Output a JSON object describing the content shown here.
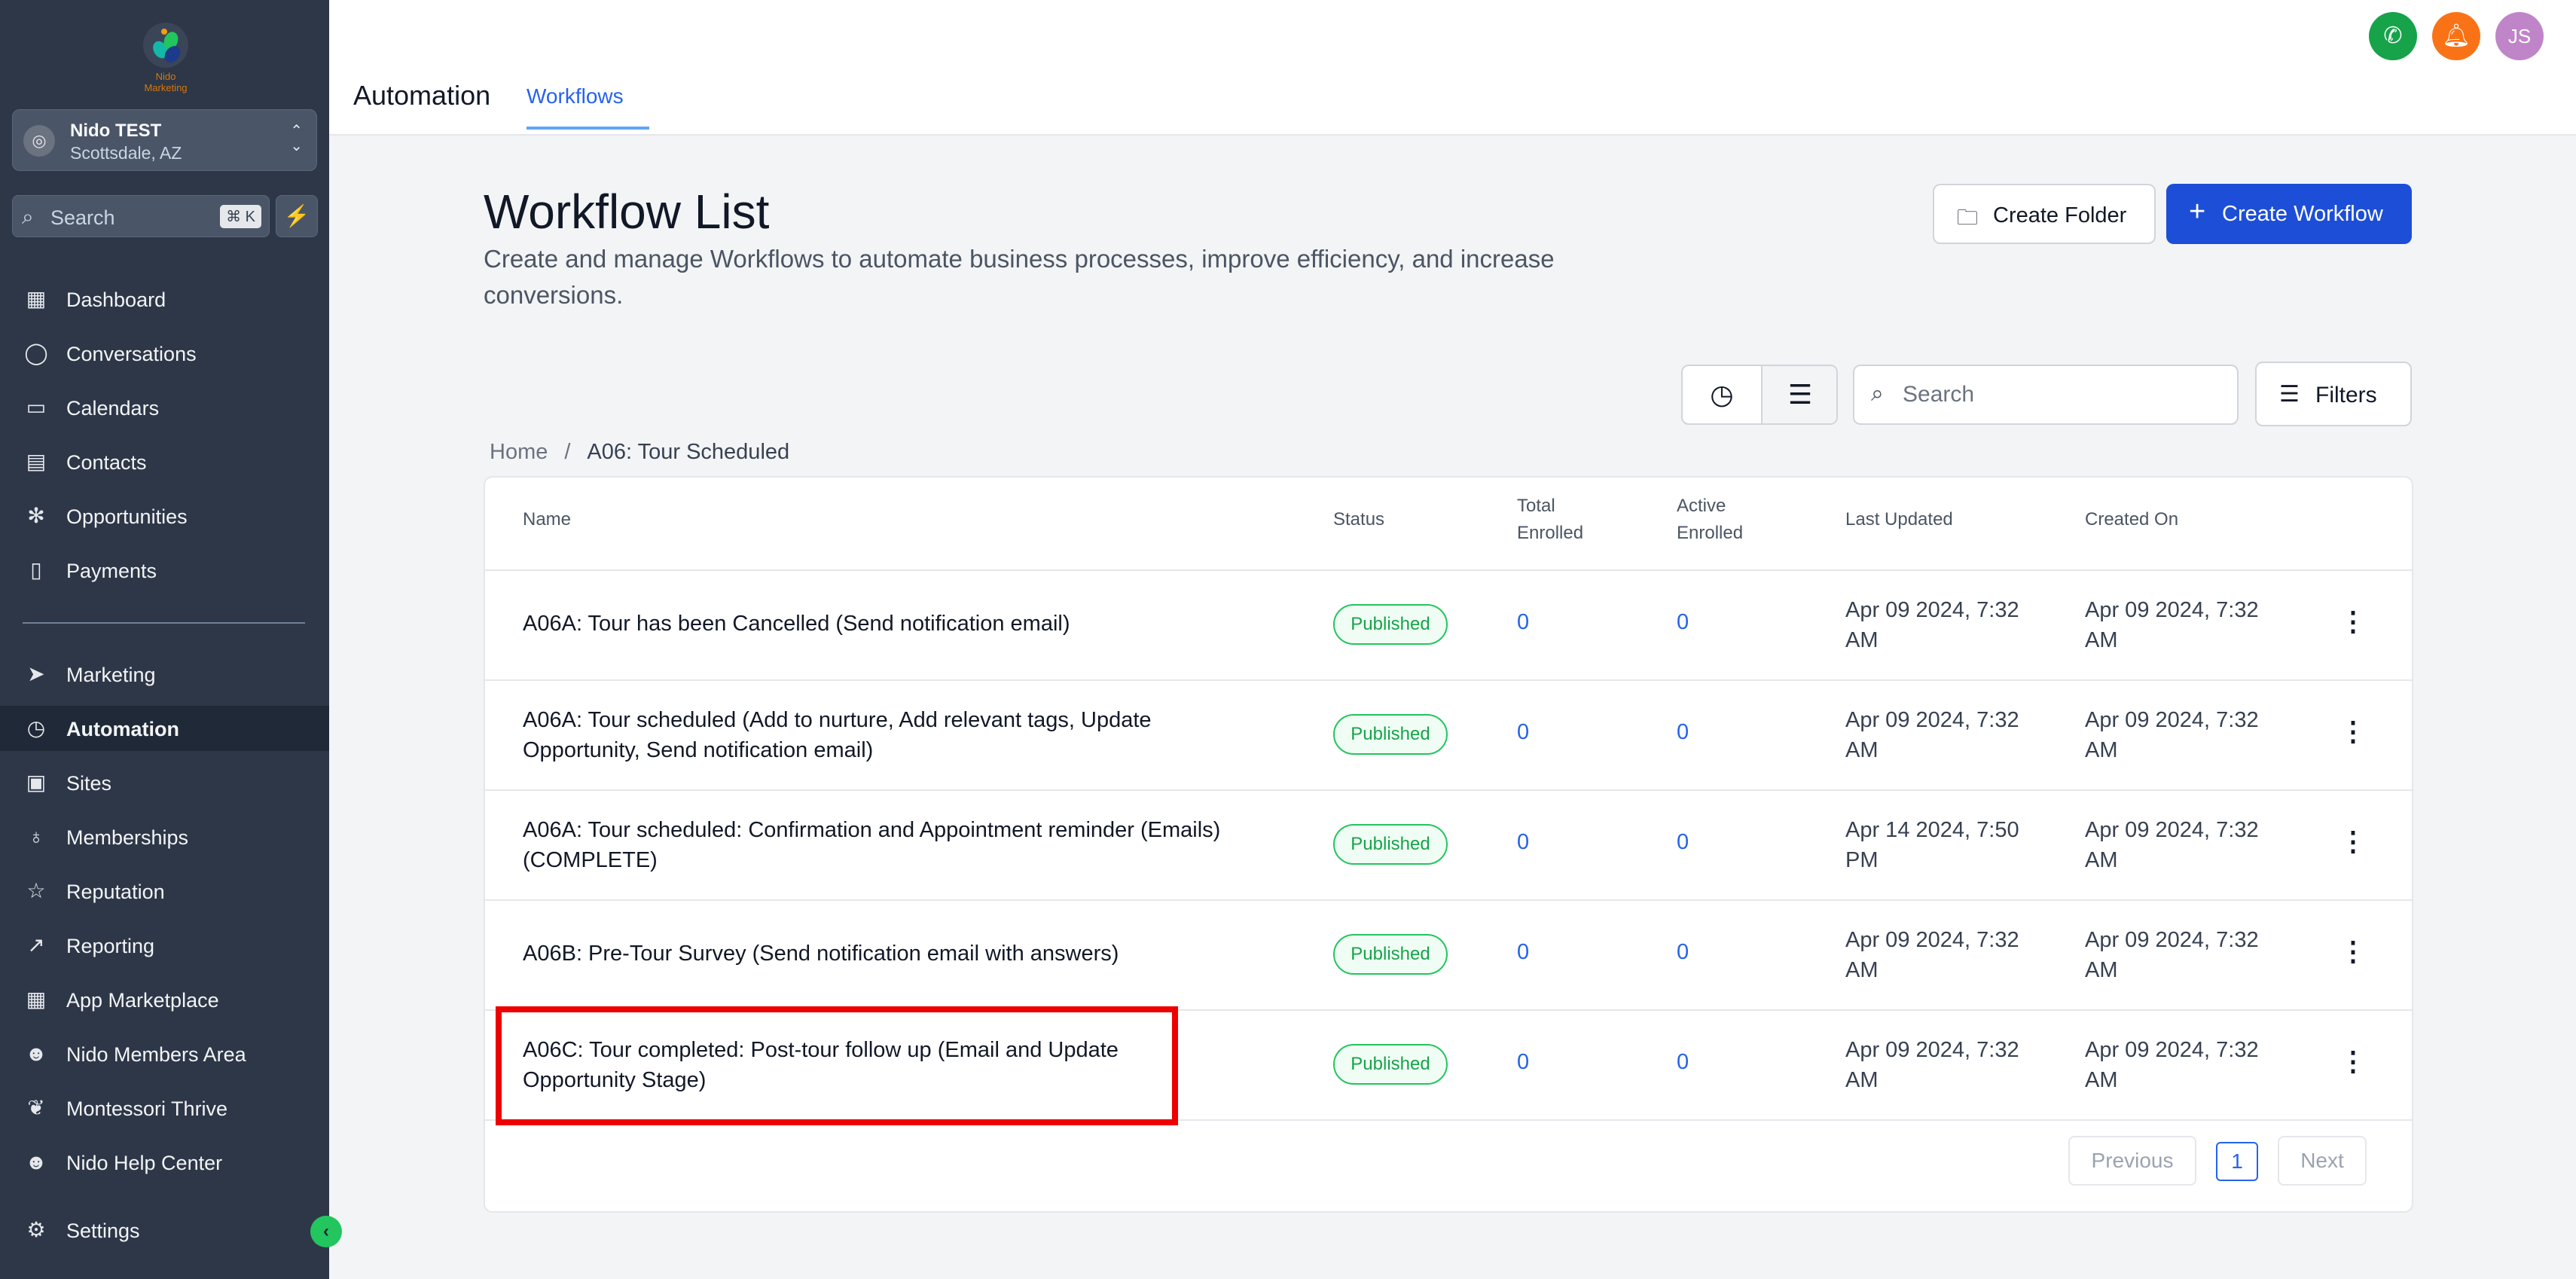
{
  "sidebar": {
    "logo_text": "Nido Marketing",
    "location": {
      "name": "Nido TEST",
      "city": "Scottsdale, AZ"
    },
    "search": {
      "placeholder": "Search",
      "shortcut": "⌘ K"
    },
    "items": [
      {
        "label": "Dashboard",
        "icon": "dashboard-icon"
      },
      {
        "label": "Conversations",
        "icon": "chat-icon"
      },
      {
        "label": "Calendars",
        "icon": "calendar-icon"
      },
      {
        "label": "Contacts",
        "icon": "contacts-icon"
      },
      {
        "label": "Opportunities",
        "icon": "opportunities-icon"
      },
      {
        "label": "Payments",
        "icon": "payments-icon"
      },
      {
        "label": "Marketing",
        "icon": "send-icon"
      },
      {
        "label": "Automation",
        "icon": "automation-icon",
        "active": true
      },
      {
        "label": "Sites",
        "icon": "sites-icon"
      },
      {
        "label": "Memberships",
        "icon": "memberships-icon"
      },
      {
        "label": "Reputation",
        "icon": "star-icon"
      },
      {
        "label": "Reporting",
        "icon": "chart-icon"
      },
      {
        "label": "App Marketplace",
        "icon": "grid-icon"
      },
      {
        "label": "Nido Members Area",
        "icon": "users-icon"
      },
      {
        "label": "Montessori Thrive",
        "icon": "leaf-icon"
      },
      {
        "label": "Nido Help Center",
        "icon": "users-icon"
      }
    ],
    "settings_label": "Settings"
  },
  "header": {
    "title": "Automation",
    "tab": "Workflows",
    "avatar_initials": "JS"
  },
  "main": {
    "title": "Workflow List",
    "description": "Create and manage Workflows to automate business processes, improve efficiency, and increase conversions.",
    "create_folder_label": "Create Folder",
    "create_workflow_label": "Create Workflow",
    "search_placeholder": "Search",
    "filters_label": "Filters",
    "breadcrumb": {
      "home": "Home",
      "sep": "/",
      "current": "A06: Tour Scheduled"
    },
    "columns": {
      "name": "Name",
      "status": "Status",
      "total_enrolled": "Total Enrolled",
      "active_enrolled": "Active Enrolled",
      "last_updated": "Last Updated",
      "created_on": "Created On"
    },
    "rows": [
      {
        "name": "A06A: Tour has been Cancelled (Send notification email)",
        "status": "Published",
        "total": "0",
        "active": "0",
        "updated": "Apr 09 2024, 7:32 AM",
        "created": "Apr 09 2024, 7:32 AM"
      },
      {
        "name": "A06A: Tour scheduled (Add to nurture, Add relevant tags, Update Opportunity, Send notification email)",
        "status": "Published",
        "total": "0",
        "active": "0",
        "updated": "Apr 09 2024, 7:32 AM",
        "created": "Apr 09 2024, 7:32 AM"
      },
      {
        "name": "A06A: Tour scheduled: Confirmation and Appointment reminder (Emails) (COMPLETE)",
        "status": "Published",
        "total": "0",
        "active": "0",
        "updated": "Apr 14 2024, 7:50 PM",
        "created": "Apr 09 2024, 7:32 AM"
      },
      {
        "name": "A06B: Pre-Tour Survey (Send notification email with answers)",
        "status": "Published",
        "total": "0",
        "active": "0",
        "updated": "Apr 09 2024, 7:32 AM",
        "created": "Apr 09 2024, 7:32 AM"
      },
      {
        "name": "A06C: Tour completed: Post-tour follow up (Email and Update Opportunity Stage)",
        "status": "Published",
        "total": "0",
        "active": "0",
        "updated": "Apr 09 2024, 7:32 AM",
        "created": "Apr 09 2024, 7:32 AM"
      }
    ],
    "pagination": {
      "previous": "Previous",
      "page": "1",
      "next": "Next"
    }
  },
  "colors": {
    "sidebar_bg": "#2d3748",
    "accent": "#1d4ed8",
    "published": "#16a34a",
    "highlight": "#ef0000"
  }
}
